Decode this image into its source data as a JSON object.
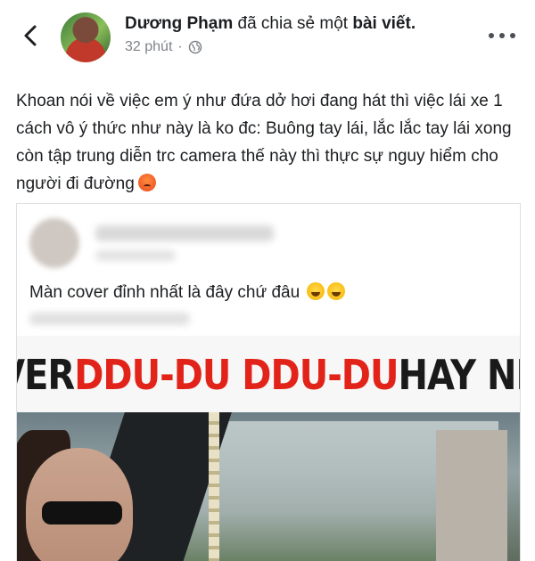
{
  "header": {
    "author": "Dương Phạm",
    "action_text": "đã chia sẻ một",
    "object_text": "bài viết.",
    "time": "32 phút",
    "separator": "·"
  },
  "post": {
    "text": "Khoan nói về việc em ý như đứa dở hơi đang hát thì việc lái xe 1 cách vô ý thức như này là ko đc: Buông tay lái, lắc lắc tay lái xong còn tập trung diễn trc camera thế này thì thực sự nguy hiểm cho người đi đường"
  },
  "shared": {
    "text": "Màn cover đỉnh nhất là đây chứ đâu"
  },
  "banner": {
    "part1": "COVER ",
    "part2": "DDU-DU DDU-DU",
    "part3": " HAY NHẤT"
  },
  "colors": {
    "banner_red": "#e2231a",
    "meta_gray": "#7f8388"
  },
  "icons": {
    "back": "chevron-left-icon",
    "privacy": "globe-icon",
    "menu": "more-dots-icon",
    "emoji_post": "angry-face-icon",
    "emoji_shared": "tears-of-joy-icon"
  }
}
